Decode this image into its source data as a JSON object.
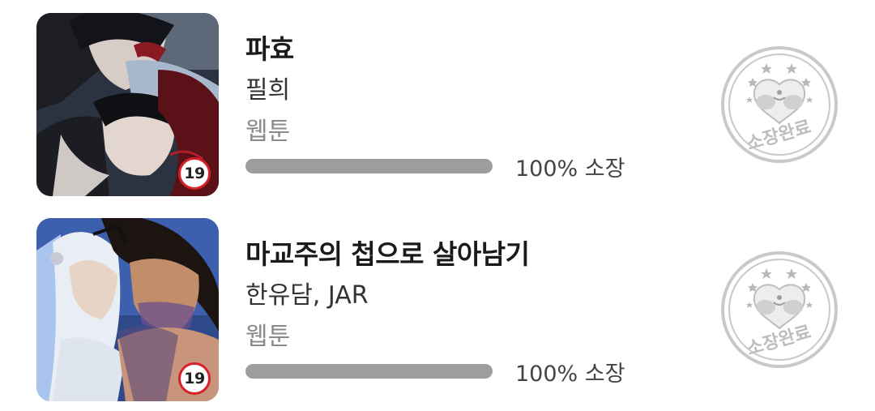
{
  "items": [
    {
      "title": "파효",
      "author": "필희",
      "genre": "웹툰",
      "progress_percent": 100,
      "progress_label": "100% 소장",
      "age_rating": "19",
      "stamp_label": "소장완료"
    },
    {
      "title": "마교주의 첩으로 살아남기",
      "author": "한유담, JAR",
      "genre": "웹툰",
      "progress_percent": 100,
      "progress_label": "100% 소장",
      "age_rating": "19",
      "stamp_label": "소장완료"
    }
  ],
  "colors": {
    "age_badge_border": "#d6202a",
    "progress_fill": "#9d9d9d",
    "progress_track": "#e2e2e2",
    "stamp": "#c9c9c9"
  },
  "icons": {
    "stamp": "owned-complete-stamp-icon",
    "age_badge": "age-19-badge-icon"
  }
}
